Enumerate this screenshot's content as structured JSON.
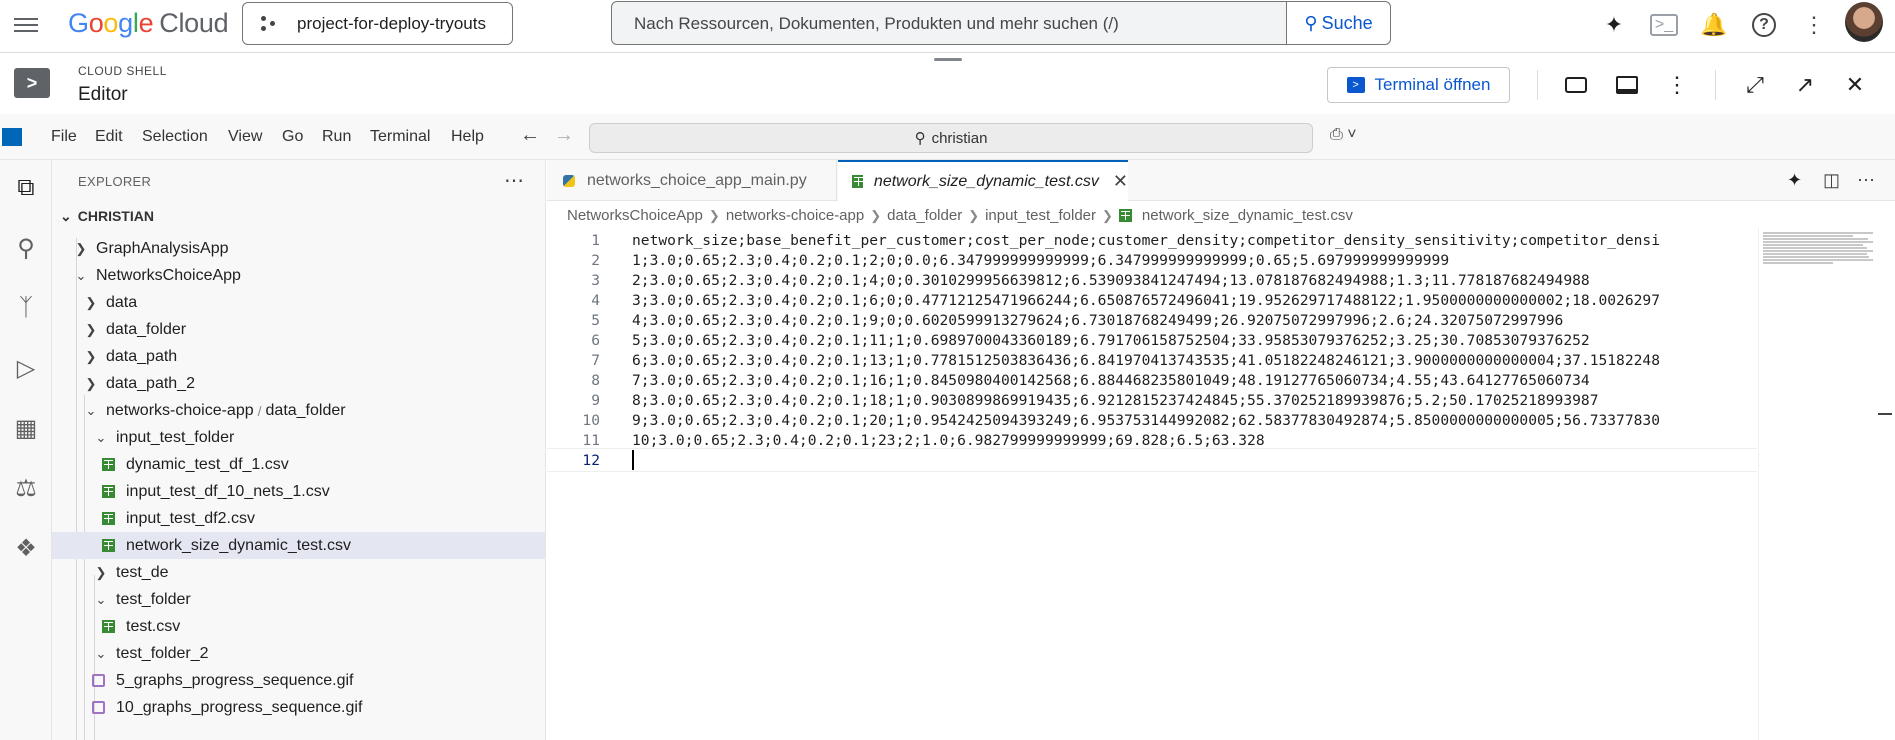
{
  "topbar": {
    "logo_google": "Google",
    "logo_cloud": "Cloud",
    "project": "project-for-deploy-tryouts",
    "search_placeholder": "Nach Ressourcen, Dokumenten, Produkten und mehr suchen (/)",
    "search_button": "Suche"
  },
  "shell": {
    "small_label": "CLOUD SHELL",
    "title": "Editor",
    "terminal_button": "Terminal öffnen"
  },
  "menubar": {
    "items": [
      "File",
      "Edit",
      "Selection",
      "View",
      "Go",
      "Run",
      "Terminal",
      "Help"
    ],
    "command_center": "christian"
  },
  "explorer": {
    "title": "EXPLORER",
    "root": "CHRISTIAN",
    "rows": [
      {
        "label": "GraphAnalysisApp",
        "kind": "folder-closed"
      },
      {
        "label": "NetworksChoiceApp",
        "kind": "folder-open"
      },
      {
        "label": "data",
        "kind": "folder-closed"
      },
      {
        "label": "data_folder",
        "kind": "folder-closed"
      },
      {
        "label": "data_path",
        "kind": "folder-closed"
      },
      {
        "label": "data_path_2",
        "kind": "folder-closed"
      },
      {
        "label": "networks-choice-app",
        "label2": "data_folder",
        "kind": "folder-open"
      },
      {
        "label": "input_test_folder",
        "kind": "folder-open"
      },
      {
        "label": "dynamic_test_df_1.csv",
        "kind": "csv"
      },
      {
        "label": "input_test_df_10_nets_1.csv",
        "kind": "csv"
      },
      {
        "label": "input_test_df2.csv",
        "kind": "csv"
      },
      {
        "label": "network_size_dynamic_test.csv",
        "kind": "csv"
      },
      {
        "label": "test_de",
        "kind": "folder-closed"
      },
      {
        "label": "test_folder",
        "kind": "folder-open"
      },
      {
        "label": "test.csv",
        "kind": "csv"
      },
      {
        "label": "test_folder_2",
        "kind": "folder-open"
      },
      {
        "label": "5_graphs_progress_sequence.gif",
        "kind": "gif"
      },
      {
        "label": "10_graphs_progress_sequence.gif",
        "kind": "gif"
      }
    ]
  },
  "editor": {
    "tabs": [
      {
        "label": "networks_choice_app_main.py",
        "active": false
      },
      {
        "label": "network_size_dynamic_test.csv",
        "active": true
      }
    ],
    "breadcrumbs": [
      "NetworksChoiceApp",
      "networks-choice-app",
      "data_folder",
      "input_test_folder",
      "network_size_dynamic_test.csv"
    ],
    "lines": [
      "network_size;base_benefit_per_customer;cost_per_node;customer_density;competitor_density_sensitivity;competitor_densi",
      "1;3.0;0.65;2.3;0.4;0.2;0.1;2;0;0.0;6.347999999999999;6.347999999999999;0.65;5.697999999999999",
      "2;3.0;0.65;2.3;0.4;0.2;0.1;4;0;0.3010299956639812;6.539093841247494;13.078187682494988;1.3;11.778187682494988",
      "3;3.0;0.65;2.3;0.4;0.2;0.1;6;0;0.47712125471966244;6.650876572496041;19.952629717488122;1.9500000000000002;18.0026297",
      "4;3.0;0.65;2.3;0.4;0.2;0.1;9;0;0.6020599913279624;6.73018768249499;26.92075072997996;2.6;24.32075072997996",
      "5;3.0;0.65;2.3;0.4;0.2;0.1;11;1;0.6989700043360189;6.791706158752504;33.95853079376252;3.25;30.70853079376252",
      "6;3.0;0.65;2.3;0.4;0.2;0.1;13;1;0.7781512503836436;6.841970413743535;41.05182248246121;3.9000000000000004;37.15182248",
      "7;3.0;0.65;2.3;0.4;0.2;0.1;16;1;0.8450980400142568;6.884468235801049;48.19127765060734;4.55;43.64127765060734",
      "8;3.0;0.65;2.3;0.4;0.2;0.1;18;1;0.9030899869919435;6.9212815237424845;55.370252189939876;5.2;50.17025218993987",
      "9;3.0;0.65;2.3;0.4;0.2;0.1;20;1;0.9542425094393249;6.953753144992082;62.58377830492874;5.8500000000000005;56.73377830",
      "10;3.0;0.65;2.3;0.4;0.2;0.1;23;2;1.0;6.982799999999999;69.828;6.5;63.328",
      ""
    ],
    "line_numbers": [
      "1",
      "2",
      "3",
      "4",
      "5",
      "6",
      "7",
      "8",
      "9",
      "10",
      "11",
      "12"
    ]
  }
}
